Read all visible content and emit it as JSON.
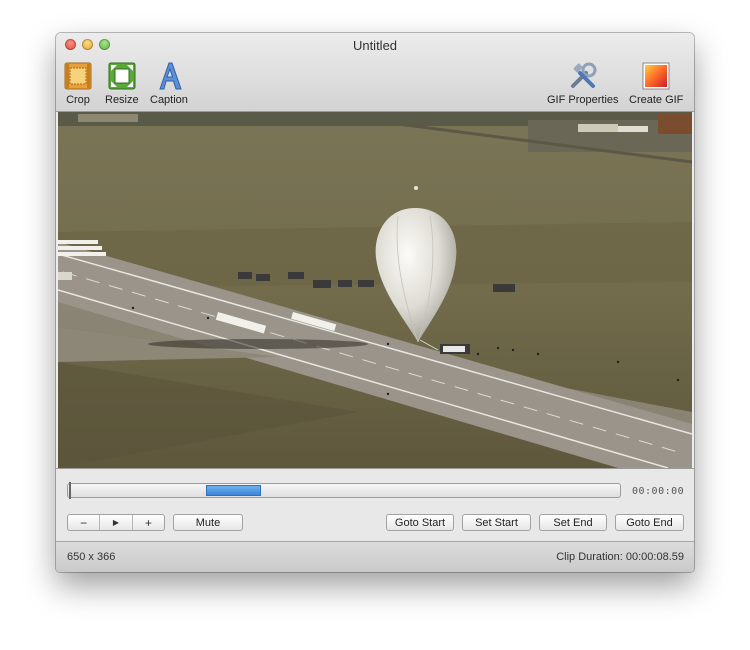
{
  "window": {
    "title": "Untitled"
  },
  "toolbar": {
    "left": [
      {
        "label": "Crop",
        "icon": "crop-icon"
      },
      {
        "label": "Resize",
        "icon": "resize-icon"
      },
      {
        "label": "Caption",
        "icon": "caption-icon"
      }
    ],
    "right": [
      {
        "label": "GIF Properties",
        "icon": "tools-icon"
      },
      {
        "label": "Create GIF",
        "icon": "gif-image-icon"
      }
    ]
  },
  "video": {
    "content": "aerial-view-of-balloon-on-runway"
  },
  "timeline": {
    "timecode": "00:00:00",
    "selection_start_fraction": 0.25,
    "selection_end_fraction": 0.35
  },
  "controls": {
    "zoom_out_label": "−",
    "play_label": "▶",
    "zoom_in_label": "+",
    "mute_label": "Mute",
    "goto_start_label": "Goto Start",
    "set_start_label": "Set Start",
    "set_end_label": "Set End",
    "goto_end_label": "Goto End"
  },
  "status": {
    "dimensions": "650 x 366",
    "clip_duration": "Clip Duration: 00:00:08.59"
  },
  "colors": {
    "selection": "#3b87d9",
    "close_light": "#e0453a",
    "minimize_light": "#e0a21f",
    "zoom_light": "#54b33a"
  }
}
